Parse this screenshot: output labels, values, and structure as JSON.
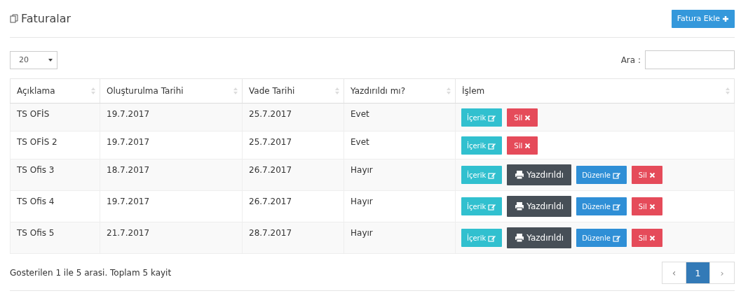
{
  "page": {
    "title": "Faturalar",
    "add_button": "Fatura Ekle"
  },
  "length_select": {
    "value": "20"
  },
  "search": {
    "label": "Ara :"
  },
  "table": {
    "columns": [
      "Açıklama",
      "Oluşturulma Tarihi",
      "Vade Tarihi",
      "Yazdırıldı mı?",
      "İşlem"
    ],
    "rows": [
      {
        "cells": [
          "TS OFİS",
          "19.7.2017",
          "25.7.2017",
          "Evet"
        ],
        "actions": [
          {
            "kind": "content",
            "label": "İçerik"
          },
          {
            "kind": "delete",
            "label": "Sil"
          }
        ]
      },
      {
        "cells": [
          "TS OFİS 2",
          "19.7.2017",
          "25.7.2017",
          "Evet"
        ],
        "actions": [
          {
            "kind": "content",
            "label": "İçerik"
          },
          {
            "kind": "delete",
            "label": "Sil"
          }
        ]
      },
      {
        "cells": [
          "TS Ofis 3",
          "18.7.2017",
          "26.7.2017",
          "Hayır"
        ],
        "actions": [
          {
            "kind": "content",
            "label": "İçerik"
          },
          {
            "kind": "print",
            "label": "Yazdırıldı"
          },
          {
            "kind": "edit",
            "label": "Düzenle"
          },
          {
            "kind": "delete",
            "label": "Sil"
          }
        ]
      },
      {
        "cells": [
          "TS Ofis 4",
          "19.7.2017",
          "26.7.2017",
          "Hayır"
        ],
        "actions": [
          {
            "kind": "content",
            "label": "İçerik"
          },
          {
            "kind": "print",
            "label": "Yazdırıldı"
          },
          {
            "kind": "edit",
            "label": "Düzenle"
          },
          {
            "kind": "delete",
            "label": "Sil"
          }
        ]
      },
      {
        "cells": [
          "TS Ofis 5",
          "21.7.2017",
          "28.7.2017",
          "Hayır"
        ],
        "actions": [
          {
            "kind": "content",
            "label": "İçerik"
          },
          {
            "kind": "print",
            "label": "Yazdırıldı"
          },
          {
            "kind": "edit",
            "label": "Düzenle"
          },
          {
            "kind": "delete",
            "label": "Sil"
          }
        ]
      }
    ]
  },
  "info": "Gosterilen 1 ile 5 arasi. Toplam 5 kayit",
  "pagination": [
    {
      "label": "‹",
      "kind": "prev",
      "selected": false
    },
    {
      "label": "1",
      "kind": "page",
      "selected": true
    },
    {
      "label": "›",
      "kind": "next",
      "selected": false
    }
  ]
}
